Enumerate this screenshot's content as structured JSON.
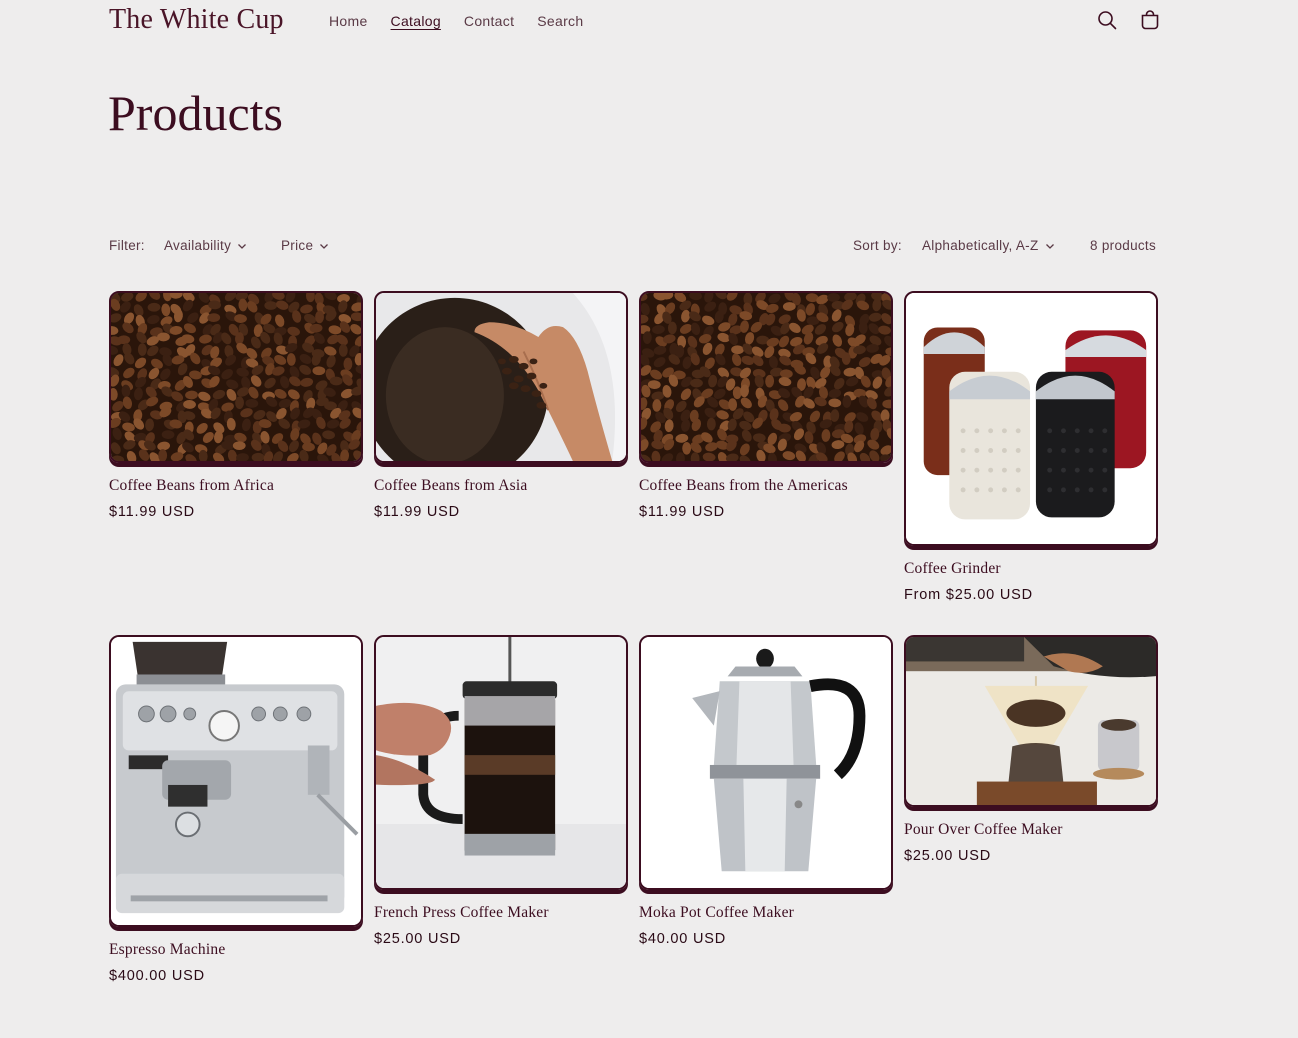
{
  "header": {
    "logo": "The White Cup",
    "nav": [
      "Home",
      "Catalog",
      "Contact",
      "Search"
    ],
    "active_nav": "Catalog",
    "icons": {
      "search": "search-icon",
      "cart": "cart-icon"
    }
  },
  "page": {
    "title": "Products"
  },
  "filters": {
    "label": "Filter:",
    "availability": "Availability",
    "price": "Price",
    "sort_label": "Sort by:",
    "sort_value": "Alphabetically, A-Z",
    "count": "8 products"
  },
  "colors": {
    "accent": "#3c0d20",
    "background": "#eeeded"
  },
  "products": [
    {
      "name": "Coffee Beans from Africa",
      "price": "$11.99 USD",
      "image": "coffee-beans"
    },
    {
      "name": "Coffee Beans from Asia",
      "price": "$11.99 USD",
      "image": "hand-with-beans"
    },
    {
      "name": "Coffee Beans from the Americas",
      "price": "$11.99 USD",
      "image": "coffee-beans"
    },
    {
      "name": "Coffee Grinder",
      "price": "From $25.00 USD",
      "image": "grinders"
    },
    {
      "name": "Espresso Machine",
      "price": "$400.00 USD",
      "image": "espresso-machine"
    },
    {
      "name": "French Press Coffee Maker",
      "price": "$25.00 USD",
      "image": "french-press"
    },
    {
      "name": "Moka Pot Coffee Maker",
      "price": "$40.00 USD",
      "image": "moka-pot"
    },
    {
      "name": "Pour Over Coffee Maker",
      "price": "$25.00 USD",
      "image": "pour-over"
    }
  ]
}
